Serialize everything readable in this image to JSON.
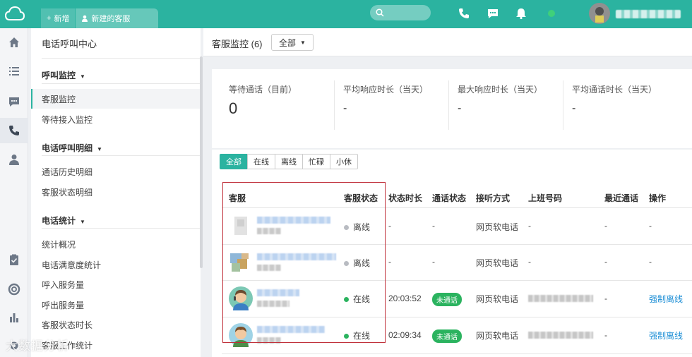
{
  "topbar": {
    "tabs": [
      {
        "label": "新增",
        "icon": "plus-icon"
      },
      {
        "label": "新建的客服",
        "icon": "user-icon"
      }
    ],
    "search": {
      "placeholder": ""
    },
    "icons": [
      "phone-icon",
      "chat-icon",
      "bell-icon",
      "status-dot-icon"
    ],
    "accent_color": "#2bb3a0"
  },
  "iconbar": {
    "items": [
      "home-icon",
      "list-icon",
      "message-icon",
      "phone-icon",
      "contact-icon",
      "task-icon",
      "help-icon",
      "stats-icon",
      "settings-icon"
    ]
  },
  "nav": {
    "title": "电话呼叫中心",
    "sections": [
      {
        "label": "呼叫监控",
        "items": [
          "客服监控",
          "等待接入监控"
        ]
      },
      {
        "label": "电话呼叫明细",
        "items": [
          "通话历史明细",
          "客服状态明细"
        ]
      },
      {
        "label": "电话统计",
        "items": [
          "统计概况",
          "电话满意度统计",
          "呼入服务量",
          "呼出服务量",
          "客服状态时长",
          "客服工作统计"
        ]
      }
    ],
    "active_item": "客服监控"
  },
  "header": {
    "title": "客服监控 (6)",
    "dropdown": "全部"
  },
  "stats": [
    {
      "label": "等待通话（目前）",
      "value": "0"
    },
    {
      "label": "平均响应时长（当天）",
      "value": "-"
    },
    {
      "label": "最大响应时长（当天）",
      "value": "-"
    },
    {
      "label": "平均通话时长（当天）",
      "value": "-"
    }
  ],
  "filters": [
    "全部",
    "在线",
    "离线",
    "忙碌",
    "小休"
  ],
  "table": {
    "columns": [
      "客服",
      "客服状态",
      "状态时长",
      "通话状态",
      "接听方式",
      "上班号码",
      "最近通话",
      "操作"
    ],
    "rows": [
      {
        "status": "离线",
        "status_color": "#b9bcc2",
        "duration": "-",
        "call_status": "-",
        "answer_mode": "网页软电话",
        "number": "-",
        "recent": "-",
        "action": "-"
      },
      {
        "status": "离线",
        "status_color": "#b9bcc2",
        "duration": "-",
        "call_status": "-",
        "answer_mode": "网页软电话",
        "number": "-",
        "recent": "-",
        "action": "-"
      },
      {
        "status": "在线",
        "status_color": "#2bb35f",
        "duration": "20:03:52",
        "call_status": "未通话",
        "answer_mode": "网页软电话",
        "number": "",
        "recent": "-",
        "action": "强制离线"
      },
      {
        "status": "在线",
        "status_color": "#2bb35f",
        "duration": "02:09:34",
        "call_status": "未通话",
        "answer_mode": "网页软电话",
        "number": "",
        "recent": "-",
        "action": "强制离线"
      }
    ]
  },
  "watermark": "大数据分析"
}
